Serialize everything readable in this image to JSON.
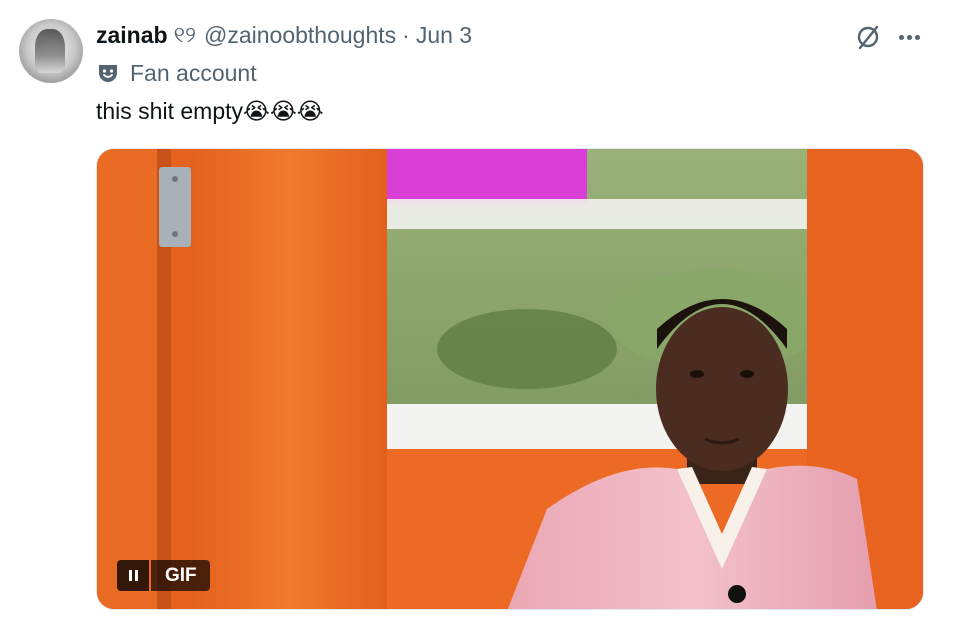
{
  "author": {
    "display_name": "zainab",
    "name_glyph": "୧୨",
    "handle": "@zainoobthoughts",
    "separator": "·",
    "date": "Jun 3"
  },
  "affiliation": {
    "label": "Fan account",
    "icon": "theater-mask-icon"
  },
  "tweet": {
    "text": "this shit empty😭😭😭"
  },
  "media": {
    "badge": "GIF",
    "playback": "paused-control"
  },
  "icons": {
    "grok": "grok-icon",
    "more": "more-icon"
  },
  "colors": {
    "text_primary": "#0f1419",
    "text_secondary": "#536471",
    "gif_orange": "#e5621f",
    "gif_magenta": "#d93fd6",
    "jacket_pink": "#f0b3bf"
  }
}
